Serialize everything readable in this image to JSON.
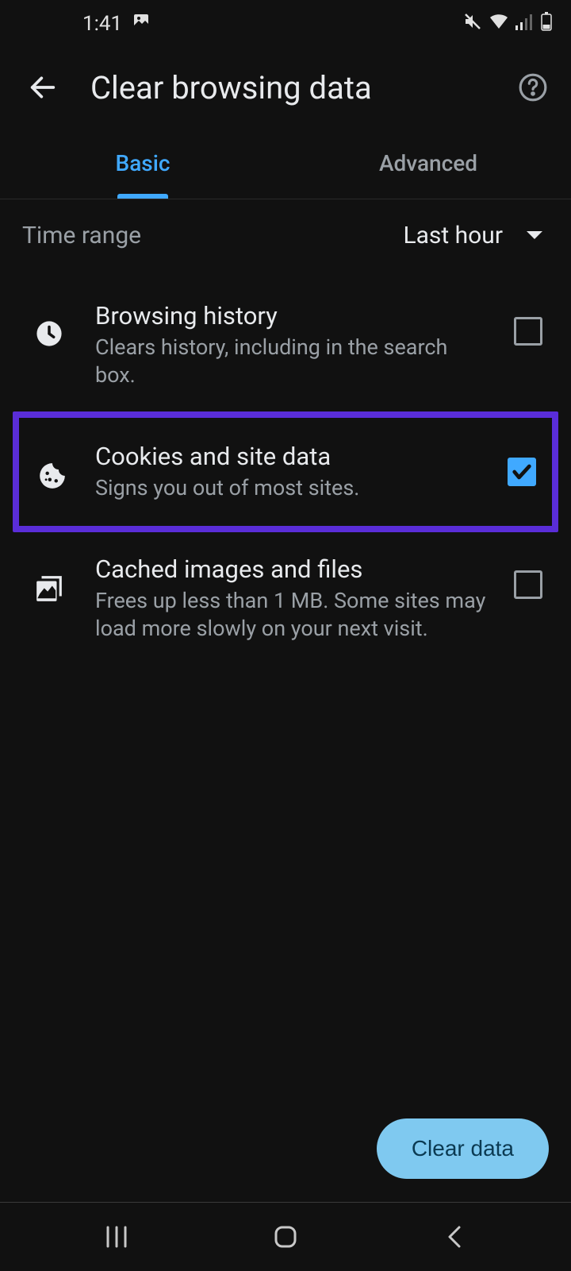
{
  "status": {
    "time": "1:41"
  },
  "header": {
    "title": "Clear browsing data"
  },
  "tabs": {
    "basic": "Basic",
    "advanced": "Advanced",
    "active": "basic"
  },
  "timeRange": {
    "label": "Time range",
    "value": "Last hour"
  },
  "options": [
    {
      "title": "Browsing history",
      "desc": "Clears history, including in the search box.",
      "checked": false
    },
    {
      "title": "Cookies and site data",
      "desc": "Signs you out of most sites.",
      "checked": true,
      "highlighted": true
    },
    {
      "title": "Cached images and files",
      "desc": "Frees up less than 1 MB. Some sites may load more slowly on your next visit.",
      "checked": false
    }
  ],
  "clearButton": "Clear data"
}
